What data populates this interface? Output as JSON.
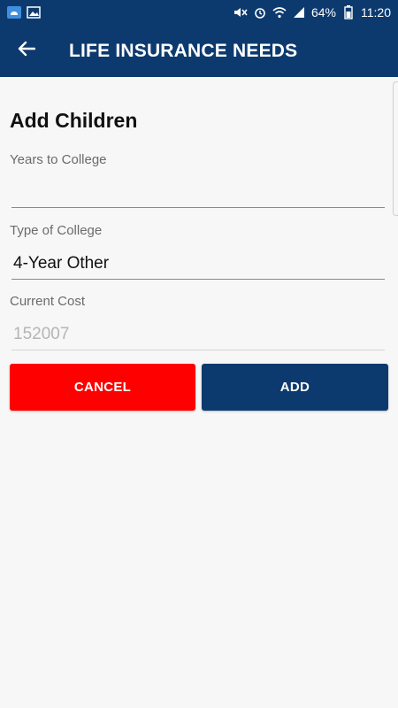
{
  "status_bar": {
    "battery": "64%",
    "time": "11:20",
    "icons_left": [
      "cloud-icon",
      "image-icon"
    ],
    "icons_right": [
      "mute-icon",
      "alarm-icon",
      "wifi-icon",
      "signal-icon",
      "battery-icon"
    ]
  },
  "app_bar": {
    "title": "LIFE INSURANCE NEEDS",
    "back_icon": "arrow-left-icon"
  },
  "form": {
    "heading": "Add Children",
    "years_to_college": {
      "label": "Years to College",
      "value": ""
    },
    "type_of_college": {
      "label": "Type of College",
      "value": "4-Year Other"
    },
    "current_cost": {
      "label": "Current Cost",
      "value": "152007"
    }
  },
  "buttons": {
    "cancel": "CANCEL",
    "add": "ADD"
  },
  "colors": {
    "primary": "#0d3a6e",
    "cancel": "#ff0000",
    "background": "#f7f7f7"
  }
}
